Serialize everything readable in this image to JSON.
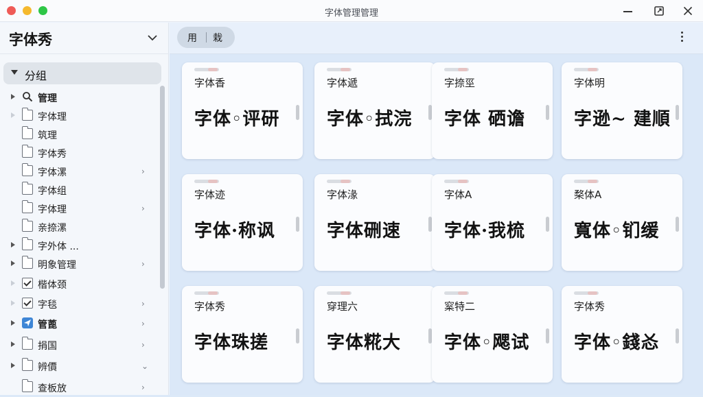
{
  "window": {
    "title": "字体管理管理"
  },
  "sidebar": {
    "title": "字体秀",
    "group_label": "分组",
    "items": [
      {
        "label": "管理",
        "icon": "search-icon",
        "bold": true,
        "arrow": "dark",
        "chevron": false
      },
      {
        "label": "字体理",
        "icon": "folder-icon",
        "bold": false,
        "arrow": "faint",
        "chevron": false
      },
      {
        "label": "筑理",
        "icon": "folder-icon",
        "bold": false,
        "arrow": "none",
        "chevron": false
      },
      {
        "label": "字体秀",
        "icon": "folder-icon",
        "bold": false,
        "arrow": "none",
        "chevron": false
      },
      {
        "label": "字体漯",
        "icon": "folder-icon",
        "bold": false,
        "arrow": "none",
        "chevron": true
      },
      {
        "label": "字体组",
        "icon": "folder-icon",
        "bold": false,
        "arrow": "none",
        "chevron": false
      },
      {
        "label": "字体理",
        "icon": "folder-icon",
        "bold": false,
        "arrow": "none",
        "chevron": true
      },
      {
        "label": "亲捺漯",
        "icon": "folder-icon",
        "bold": false,
        "arrow": "none",
        "chevron": false
      },
      {
        "label": "字外体 ...",
        "icon": "folder-icon",
        "bold": false,
        "arrow": "dark",
        "chevron": false
      },
      {
        "label": "明象管理",
        "icon": "folder-icon",
        "bold": false,
        "arrow": "dark",
        "chevron": true
      },
      {
        "label": "楷体颈",
        "icon": "checkbox-icon",
        "bold": false,
        "arrow": "faint",
        "chevron": false
      },
      {
        "label": "字毯",
        "icon": "checkbox-icon",
        "bold": false,
        "arrow": "faint",
        "chevron": true
      },
      {
        "label": "管蓖",
        "icon": "send-icon",
        "bold": true,
        "arrow": "dark",
        "chevron": true
      },
      {
        "label": "捐国",
        "icon": "folder-icon",
        "bold": false,
        "arrow": "dark",
        "chevron": true
      },
      {
        "label": "辨價",
        "icon": "folder-icon",
        "bold": false,
        "arrow": "dark",
        "chevron": "down"
      },
      {
        "label": "查板放",
        "icon": "folder-icon",
        "bold": false,
        "arrow": "none",
        "chevron": true
      }
    ]
  },
  "toolbar": {
    "seg_left": "用",
    "seg_right": "栽"
  },
  "cards": [
    {
      "name": "字体香",
      "sample": "字体◦评研"
    },
    {
      "name": "字体遞",
      "sample": "字体◦拭浣"
    },
    {
      "name": "字捺巠",
      "sample": "字体 硒谵"
    },
    {
      "name": "字体明",
      "sample": "字逊~ 建順"
    },
    {
      "name": "字体迹",
      "sample": "字体·称讽"
    },
    {
      "name": "字体湪",
      "sample": "字体硎速"
    },
    {
      "name": "字体A",
      "sample": "字体·我梳"
    },
    {
      "name": "楘体A",
      "sample": "寬体◦钔缓"
    },
    {
      "name": "字体秀",
      "sample": "字体珠搓"
    },
    {
      "name": "穿理六",
      "sample": "字体糀大"
    },
    {
      "name": "梥特二",
      "sample": "字体◦飔试"
    },
    {
      "name": "字体秀",
      "sample": "字体◦錢㣻"
    }
  ]
}
